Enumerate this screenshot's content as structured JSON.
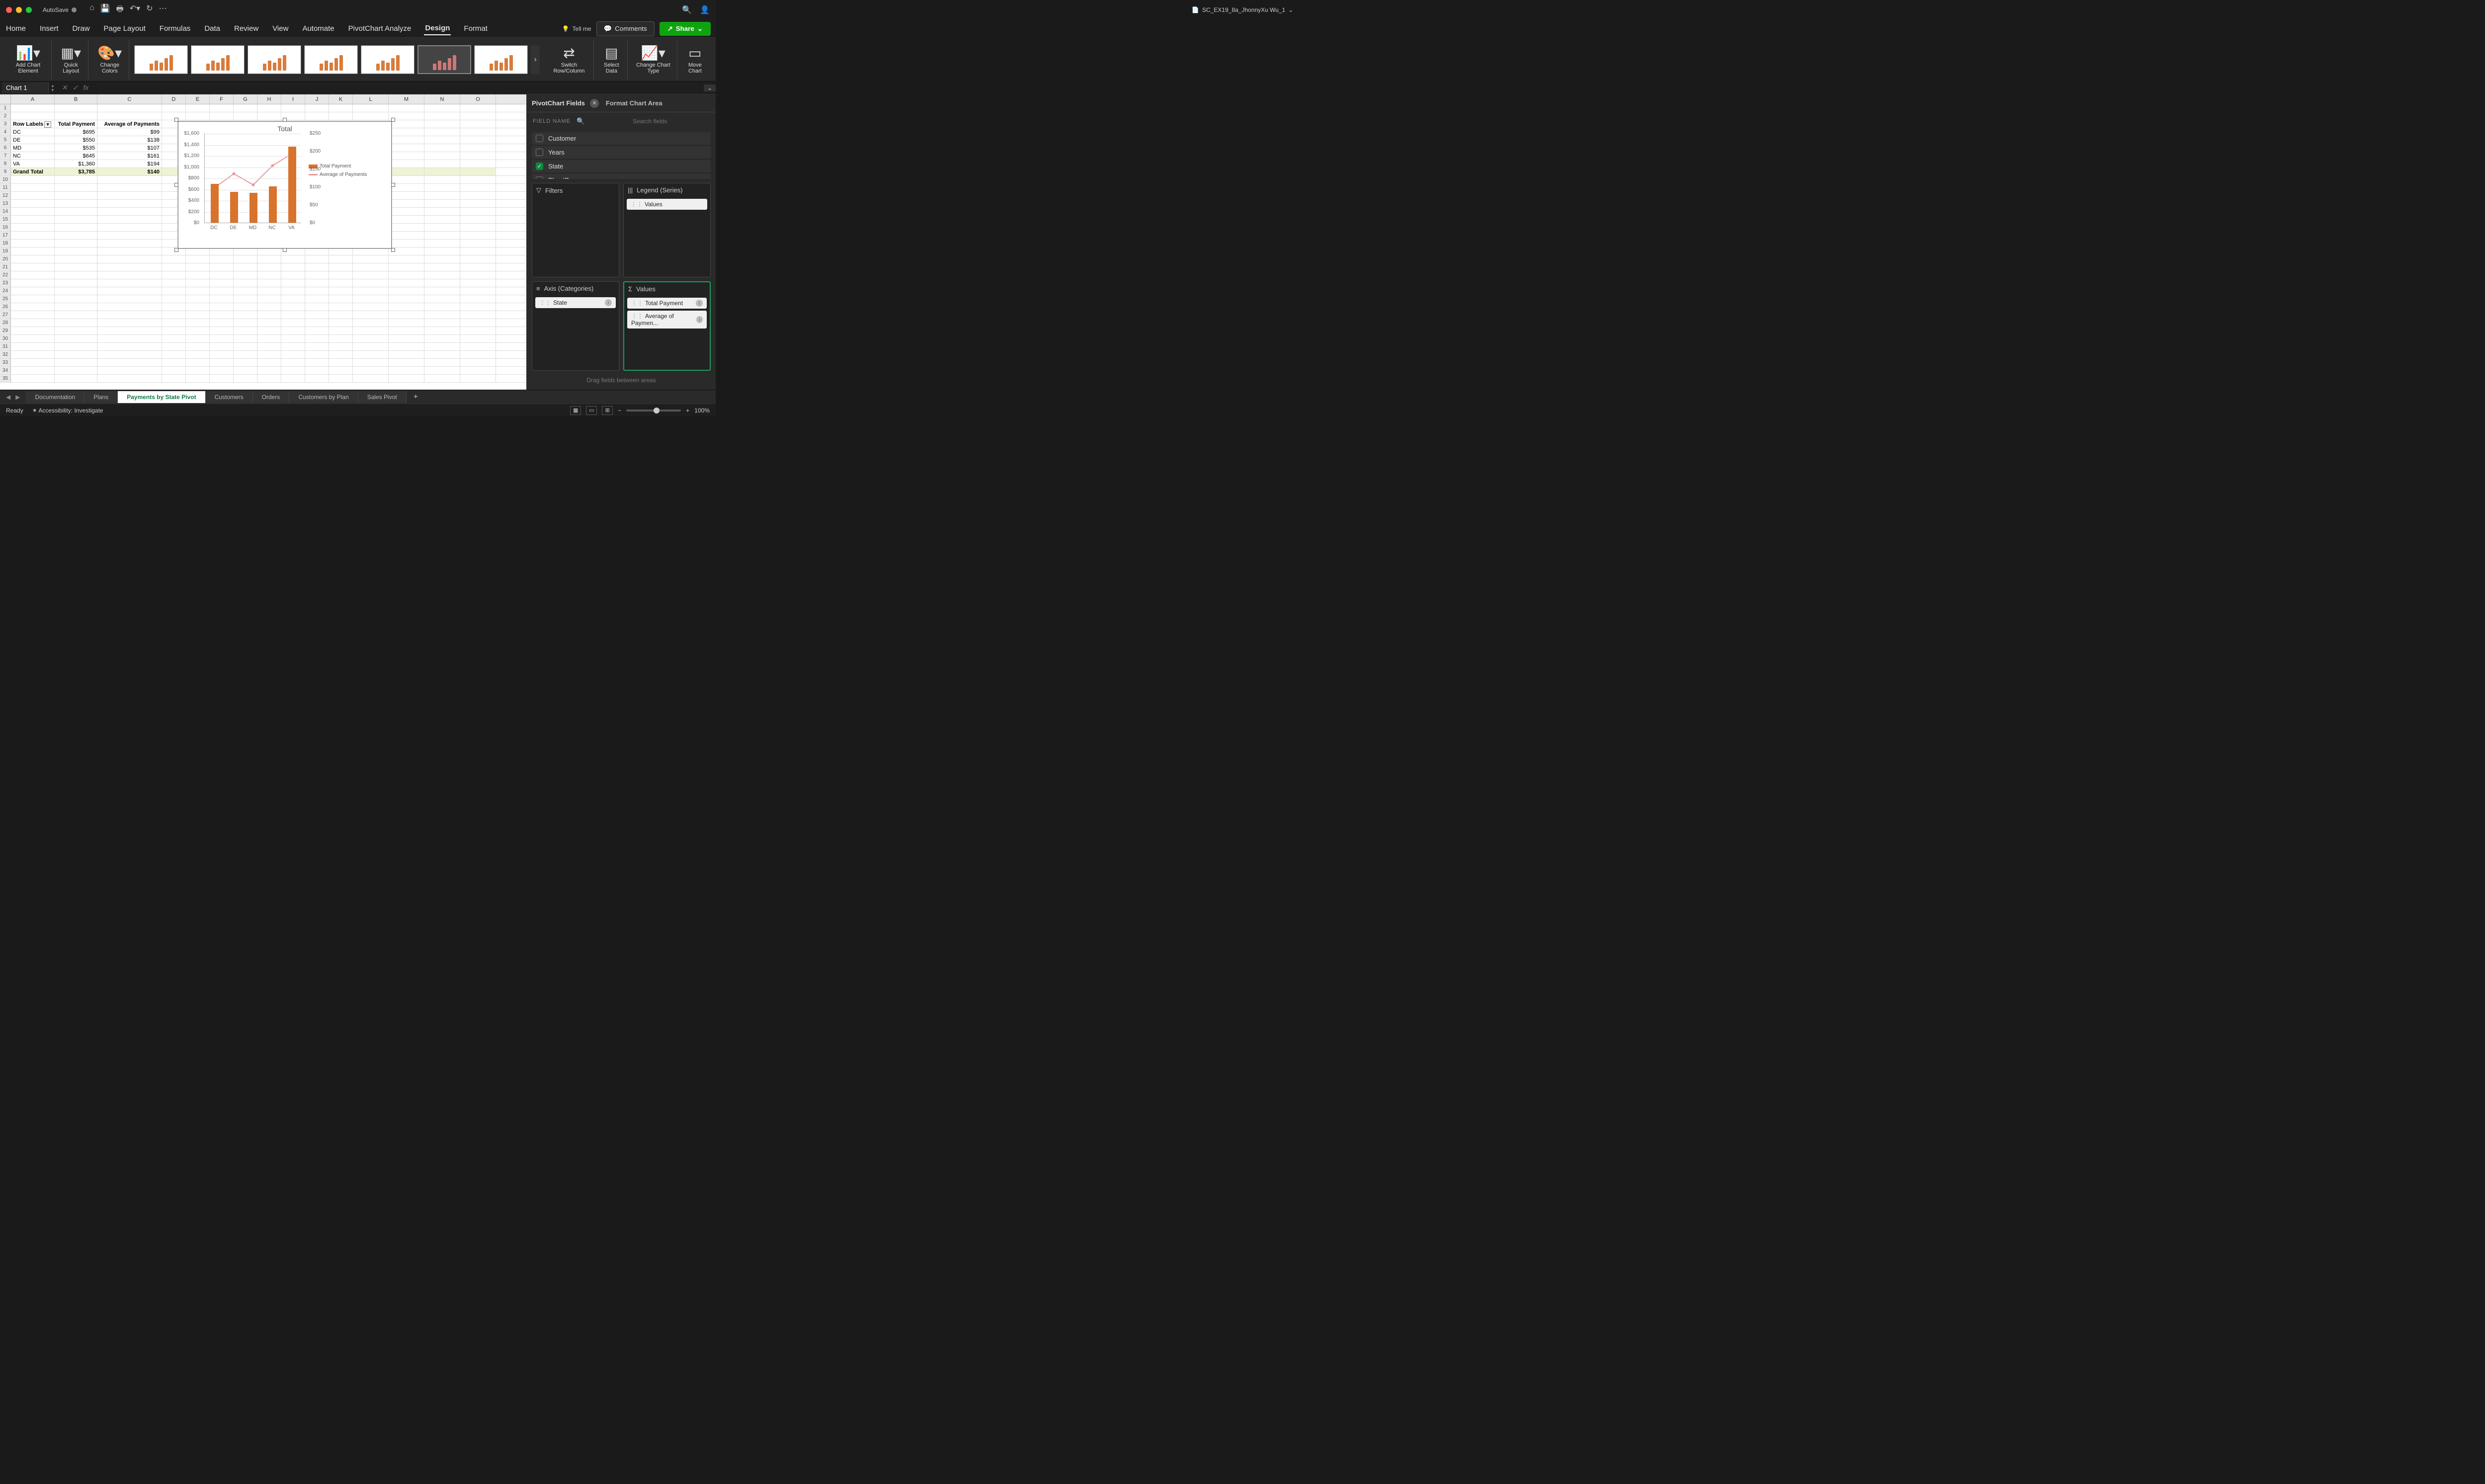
{
  "titlebar": {
    "autosave": "AutoSave",
    "doc_name": "SC_EX19_8a_JhonnyXu Wu_1"
  },
  "ribbon_tabs": [
    "Home",
    "Insert",
    "Draw",
    "Page Layout",
    "Formulas",
    "Data",
    "Review",
    "View",
    "Automate",
    "PivotChart Analyze",
    "Design",
    "Format"
  ],
  "active_tab": "Design",
  "tellme": "Tell me",
  "comments": "Comments",
  "share": "Share",
  "ribbon": {
    "add_element": "Add Chart Element",
    "quick_layout": "Quick Layout",
    "change_colors": "Change Colors",
    "switch_rc": "Switch Row/Column",
    "select_data": "Select Data",
    "change_type": "Change Chart Type",
    "move_chart": "Move Chart"
  },
  "namebox": "Chart 1",
  "sheet": {
    "headers": [
      "Row Labels",
      "Total Payment",
      "Average of Payments"
    ],
    "rows": [
      {
        "label": "DC",
        "total": "$695",
        "avg": "$99"
      },
      {
        "label": "DE",
        "total": "$550",
        "avg": "$138"
      },
      {
        "label": "MD",
        "total": "$535",
        "avg": "$107"
      },
      {
        "label": "NC",
        "total": "$645",
        "avg": "$161"
      },
      {
        "label": "VA",
        "total": "$1,360",
        "avg": "$194"
      }
    ],
    "grand": {
      "label": "Grand Total",
      "total": "$3,785",
      "avg": "$140"
    }
  },
  "chart_data": {
    "type": "bar+line",
    "title": "Total",
    "categories": [
      "DC",
      "DE",
      "MD",
      "NC",
      "VA"
    ],
    "series": [
      {
        "name": "Total Payment",
        "type": "bar",
        "axis": "y1",
        "values": [
          695,
          550,
          535,
          645,
          1360
        ]
      },
      {
        "name": "Average of Payments",
        "type": "line",
        "axis": "y2",
        "values": [
          99,
          138,
          107,
          161,
          194
        ]
      }
    ],
    "y1_ticks": [
      "$0",
      "$200",
      "$400",
      "$600",
      "$800",
      "$1,000",
      "$1,200",
      "$1,400",
      "$1,600"
    ],
    "y1_range": [
      0,
      1600
    ],
    "y2_ticks": [
      "$0",
      "$50",
      "$100",
      "$150",
      "$200",
      "$250"
    ],
    "y2_range": [
      0,
      250
    ],
    "legend": [
      "Total Payment",
      "Average of Payments"
    ]
  },
  "panel": {
    "title": "PivotChart Fields",
    "title2": "Format Chart Area",
    "field_name_label": "FIELD NAME",
    "search_placeholder": "Search fields",
    "fields": [
      {
        "name": "Customer",
        "checked": false
      },
      {
        "name": "Years",
        "checked": false
      },
      {
        "name": "State",
        "checked": true
      },
      {
        "name": "Plan ID",
        "checked": false
      }
    ],
    "filters_label": "Filters",
    "legend_label": "Legend (Series)",
    "axis_label": "Axis (Categories)",
    "values_label": "Values",
    "legend_items": [
      "Values"
    ],
    "axis_items": [
      "State"
    ],
    "values_items": [
      "Total Payment",
      "Average of Paymen..."
    ],
    "drag_hint": "Drag fields between areas"
  },
  "sheet_tabs": [
    "Documentation",
    "Plans",
    "Payments by State Pivot",
    "Customers",
    "Orders",
    "Customers by Plan",
    "Sales Pivot"
  ],
  "active_sheet": "Payments by State Pivot",
  "status": {
    "ready": "Ready",
    "accessibility": "Accessibility: Investigate",
    "zoom": "100%"
  }
}
